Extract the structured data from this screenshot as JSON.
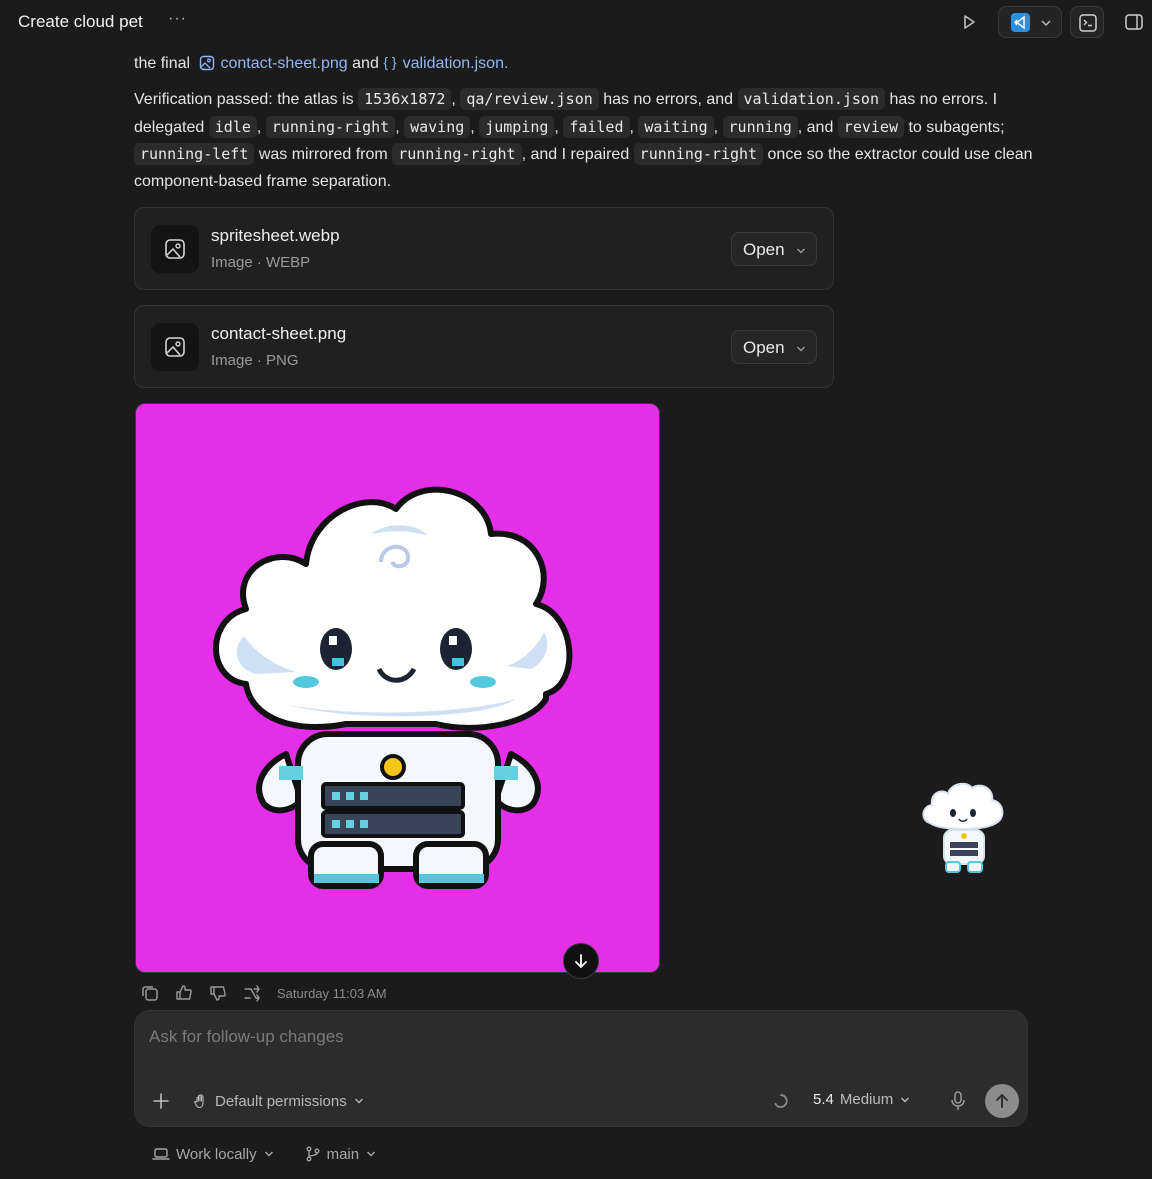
{
  "window": {
    "title": "Create cloud pet",
    "more": "···"
  },
  "message": {
    "intro": {
      "prefix": "the final",
      "file1": "contact-sheet.png",
      "middle": "and",
      "file2": "validation.json",
      "suffix": "."
    },
    "p": {
      "t1": "Verification passed: the atlas is",
      "c1": "1536x1872",
      "t2": ",",
      "c2": "qa/review.json",
      "t3": "has no errors, and",
      "c3": "validation.json",
      "t4": "has no errors. I delegated",
      "c4": "idle",
      "t5": ",",
      "c5": "running-right",
      "t6": ",",
      "c6": "waving",
      "t7": ",",
      "c7": "jumping",
      "t8": ",",
      "c8": "failed",
      "t9": ",",
      "c9": "waiting",
      "t10": ",",
      "c10": "running",
      "t11": ", and",
      "c11": "review",
      "t12": "to subagents;",
      "c12": "running-left",
      "t13": "was mirrored from",
      "c13": "running-right",
      "t14": ", and I repaired",
      "c14": "running-right",
      "t15": "once so the extractor could use clean component-based frame separation."
    }
  },
  "attachments": [
    {
      "name": "spritesheet.webp",
      "meta": "Image · WEBP",
      "action": "Open"
    },
    {
      "name": "contact-sheet.png",
      "meta": "Image · PNG",
      "action": "Open"
    }
  ],
  "message_meta": {
    "timestamp": "Saturday 11:03 AM"
  },
  "composer": {
    "placeholder": "Ask for follow-up changes",
    "permissions": "Default permissions",
    "model_version": "5.4",
    "model_effort": "Medium"
  },
  "footer": {
    "location": "Work locally",
    "branch": "main"
  },
  "colors": {
    "background": "#1b1b1b",
    "preview_bg": "#e42ee8",
    "link": "#8fb6f5",
    "composer": "#2c2c2c"
  },
  "icons": [
    "run-icon",
    "vscode-icon",
    "terminal-icon",
    "panel-icon",
    "image-file-icon",
    "json-icon",
    "chevron-down-icon",
    "arrow-down-icon",
    "copy-icon",
    "thumbs-up-icon",
    "thumbs-down-icon",
    "fork-icon",
    "plus-icon",
    "hand-icon",
    "spinner-icon",
    "mic-icon",
    "send-icon",
    "laptop-icon",
    "branch-icon"
  ]
}
